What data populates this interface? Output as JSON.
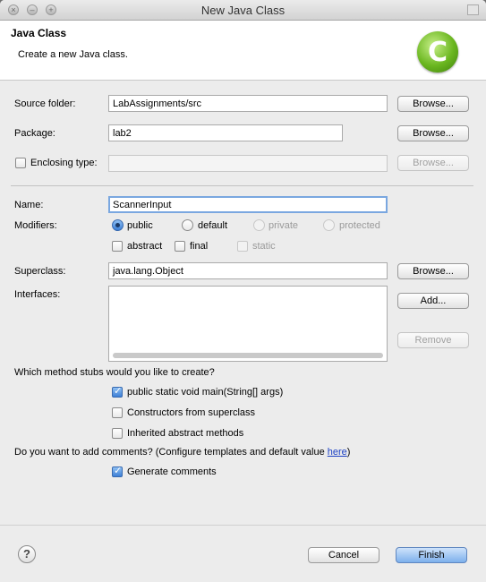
{
  "window": {
    "title": "New Java Class"
  },
  "header": {
    "title": "Java Class",
    "description": "Create a new Java class.",
    "logo_letter": "C"
  },
  "source_folder": {
    "label": "Source folder:",
    "value": "LabAssignments/src",
    "browse": "Browse..."
  },
  "package": {
    "label": "Package:",
    "value": "lab2",
    "browse": "Browse..."
  },
  "enclosing": {
    "label": "Enclosing type:",
    "value": "",
    "browse": "Browse...",
    "checked": false
  },
  "name": {
    "label": "Name:",
    "value": "ScannerInput"
  },
  "modifiers": {
    "label": "Modifiers:",
    "public": "public",
    "default": "default",
    "private": "private",
    "protected": "protected",
    "abstract": "abstract",
    "final": "final",
    "static": "static"
  },
  "superclass": {
    "label": "Superclass:",
    "value": "java.lang.Object",
    "browse": "Browse..."
  },
  "interfaces": {
    "label": "Interfaces:",
    "add": "Add...",
    "remove": "Remove"
  },
  "stubs": {
    "question": "Which method stubs would you like to create?",
    "main": "public static void main(String[] args)",
    "constructors": "Constructors from superclass",
    "inherited": "Inherited abstract methods"
  },
  "comments": {
    "question": "Do you want to add comments? (Configure templates and default value ",
    "link": "here",
    "close": ")",
    "generate": "Generate comments"
  },
  "footer": {
    "help": "?",
    "cancel": "Cancel",
    "finish": "Finish"
  }
}
